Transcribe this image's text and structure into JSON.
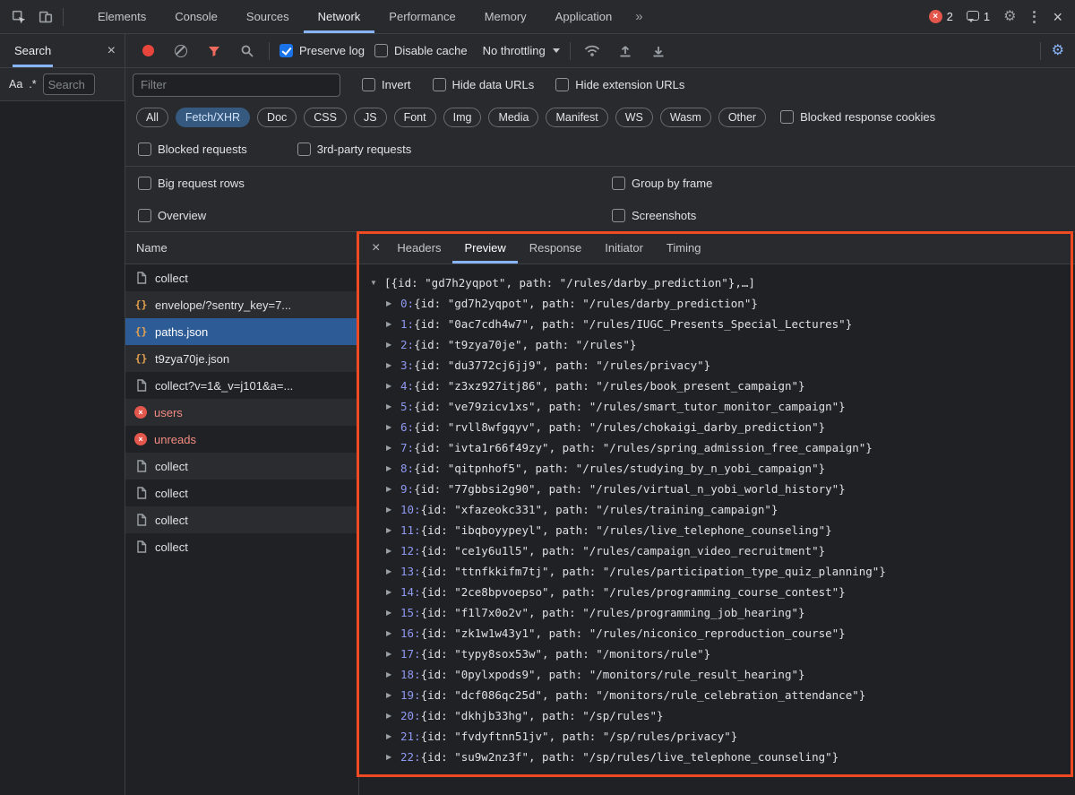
{
  "colors": {
    "accent_blue": "#8ab4f8",
    "checkbox_blue": "#1a73e8",
    "selected_row_blue": "#2d5b96",
    "error_red": "#f28b82",
    "json_icon_orange": "#e5a14e",
    "highlight_rect": "#f04a23",
    "active_chip_bg": "#35597f"
  },
  "icons": {
    "more_tabs": "»",
    "close": "×",
    "error_x": "×",
    "expanded_arrow": "▼",
    "collapsed_arrow": "▶",
    "json_braces": "{}"
  },
  "devtools_tabs": {
    "items": [
      "Elements",
      "Console",
      "Sources",
      "Network",
      "Performance",
      "Memory",
      "Application"
    ],
    "active": "Network"
  },
  "status": {
    "error_count": "2",
    "issue_count": "1"
  },
  "search_panel": {
    "tab_label": "Search",
    "match_case_label": "Aa",
    "regex_label": ".*",
    "input_placeholder": "Search"
  },
  "toolbar": {
    "preserve_log_label": "Preserve log",
    "disable_cache_label": "Disable cache",
    "throttling_value": "No throttling"
  },
  "filters": {
    "filter_placeholder": "Filter",
    "invert_label": "Invert",
    "hide_data_urls_label": "Hide data URLs",
    "hide_extension_urls_label": "Hide extension URLs",
    "chips": [
      "All",
      "Fetch/XHR",
      "Doc",
      "CSS",
      "JS",
      "Font",
      "Img",
      "Media",
      "Manifest",
      "WS",
      "Wasm",
      "Other"
    ],
    "active_chip": "Fetch/XHR",
    "blocked_response_cookies_label": "Blocked response cookies",
    "blocked_requests_label": "Blocked requests",
    "third_party_requests_label": "3rd-party requests"
  },
  "settings_panel": {
    "big_request_rows_label": "Big request rows",
    "group_by_frame_label": "Group by frame",
    "overview_label": "Overview",
    "screenshots_label": "Screenshots"
  },
  "requests_table": {
    "name_header": "Name",
    "rows": [
      {
        "name": "collect",
        "icon": "document",
        "selected": false,
        "error": false
      },
      {
        "name": "envelope/?sentry_key=7...",
        "icon": "json",
        "selected": false,
        "error": false
      },
      {
        "name": "paths.json",
        "icon": "json",
        "selected": true,
        "error": false
      },
      {
        "name": "t9zya70je.json",
        "icon": "json",
        "selected": false,
        "error": false
      },
      {
        "name": "collect?v=1&_v=j101&a=...",
        "icon": "document",
        "selected": false,
        "error": false
      },
      {
        "name": "users",
        "icon": "error",
        "selected": false,
        "error": true
      },
      {
        "name": "unreads",
        "icon": "error",
        "selected": false,
        "error": true
      },
      {
        "name": "collect",
        "icon": "document",
        "selected": false,
        "error": false
      },
      {
        "name": "collect",
        "icon": "document",
        "selected": false,
        "error": false
      },
      {
        "name": "collect",
        "icon": "document",
        "selected": false,
        "error": false
      },
      {
        "name": "collect",
        "icon": "document",
        "selected": false,
        "error": false
      }
    ]
  },
  "detail_panel": {
    "tabs": [
      "Headers",
      "Preview",
      "Response",
      "Initiator",
      "Timing"
    ],
    "active_tab": "Preview",
    "preview_root": "[{id: \"gd7h2yqpot\", path: \"/rules/darby_prediction\"},…]",
    "preview_items": [
      {
        "index": "0",
        "body": "{id: \"gd7h2yqpot\", path: \"/rules/darby_prediction\"}"
      },
      {
        "index": "1",
        "body": "{id: \"0ac7cdh4w7\", path: \"/rules/IUGC_Presents_Special_Lectures\"}"
      },
      {
        "index": "2",
        "body": "{id: \"t9zya70je\", path: \"/rules\"}"
      },
      {
        "index": "3",
        "body": "{id: \"du3772cj6jj9\", path: \"/rules/privacy\"}"
      },
      {
        "index": "4",
        "body": "{id: \"z3xz927itj86\", path: \"/rules/book_present_campaign\"}"
      },
      {
        "index": "5",
        "body": "{id: \"ve79zicv1xs\", path: \"/rules/smart_tutor_monitor_campaign\"}"
      },
      {
        "index": "6",
        "body": "{id: \"rvll8wfgqyv\", path: \"/rules/chokaigi_darby_prediction\"}"
      },
      {
        "index": "7",
        "body": "{id: \"ivta1r66f49zy\", path: \"/rules/spring_admission_free_campaign\"}"
      },
      {
        "index": "8",
        "body": "{id: \"qitpnhof5\", path: \"/rules/studying_by_n_yobi_campaign\"}"
      },
      {
        "index": "9",
        "body": "{id: \"77gbbsi2g90\", path: \"/rules/virtual_n_yobi_world_history\"}"
      },
      {
        "index": "10",
        "body": "{id: \"xfazeokc331\", path: \"/rules/training_campaign\"}"
      },
      {
        "index": "11",
        "body": "{id: \"ibqboyypeyl\", path: \"/rules/live_telephone_counseling\"}"
      },
      {
        "index": "12",
        "body": "{id: \"ce1y6u1l5\", path: \"/rules/campaign_video_recruitment\"}"
      },
      {
        "index": "13",
        "body": "{id: \"ttnfkkifm7tj\", path: \"/rules/participation_type_quiz_planning\"}"
      },
      {
        "index": "14",
        "body": "{id: \"2ce8bpvoepso\", path: \"/rules/programming_course_contest\"}"
      },
      {
        "index": "15",
        "body": "{id: \"f1l7x0o2v\", path: \"/rules/programming_job_hearing\"}"
      },
      {
        "index": "16",
        "body": "{id: \"zk1w1w43y1\", path: \"/rules/niconico_reproduction_course\"}"
      },
      {
        "index": "17",
        "body": "{id: \"typy8sox53w\", path: \"/monitors/rule\"}"
      },
      {
        "index": "18",
        "body": "{id: \"0pylxpods9\", path: \"/monitors/rule_result_hearing\"}"
      },
      {
        "index": "19",
        "body": "{id: \"dcf086qc25d\", path: \"/monitors/rule_celebration_attendance\"}"
      },
      {
        "index": "20",
        "body": "{id: \"dkhjb33hg\", path: \"/sp/rules\"}"
      },
      {
        "index": "21",
        "body": "{id: \"fvdyftnn51jv\", path: \"/sp/rules/privacy\"}"
      },
      {
        "index": "22",
        "body": "{id: \"su9w2nz3f\", path: \"/sp/rules/live_telephone_counseling\"}"
      }
    ]
  }
}
